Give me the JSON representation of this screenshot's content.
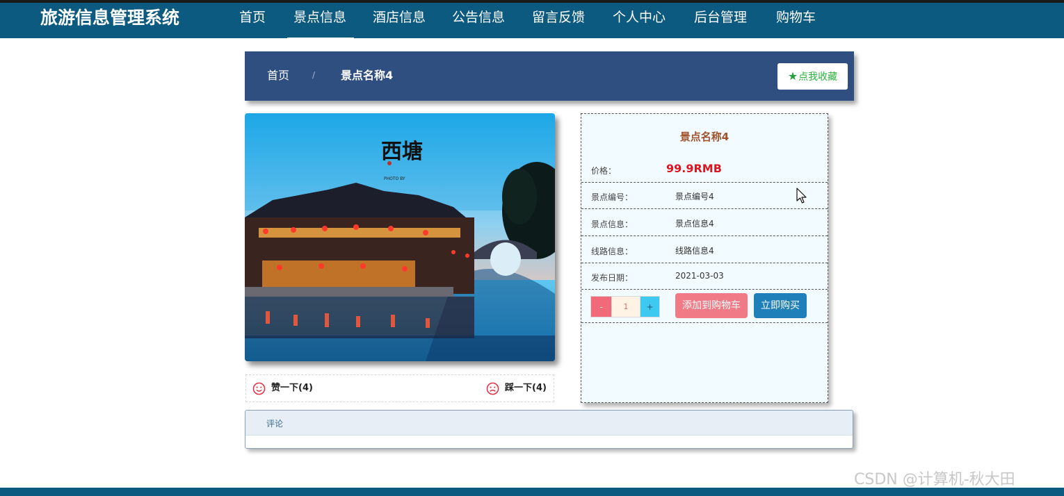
{
  "nav": {
    "brand": "旅游信息管理系统",
    "items": [
      {
        "label": "首页"
      },
      {
        "label": "景点信息"
      },
      {
        "label": "酒店信息"
      },
      {
        "label": "公告信息"
      },
      {
        "label": "留言反馈"
      },
      {
        "label": "个人中心"
      },
      {
        "label": "后台管理"
      },
      {
        "label": "购物车"
      }
    ],
    "active": "景点信息"
  },
  "breadcrumb": {
    "home": "首页",
    "separator": "/",
    "current": "景点名称4",
    "favorite_icon": "star-icon",
    "favorite_label": "点我收藏"
  },
  "votes": {
    "like_icon": "smile-icon",
    "like_label": "赞一下(4)",
    "dislike_icon": "sad-face-icon",
    "dislike_label": "踩一下(4)"
  },
  "detail": {
    "title": "景点名称4",
    "price_label": "价格：",
    "price_value": "99.9RMB",
    "fields": [
      {
        "label": "景点编号：",
        "value": "景点编号4"
      },
      {
        "label": "景点信息：",
        "value": "景点信息4"
      },
      {
        "label": "线路信息：",
        "value": "线路信息4"
      },
      {
        "label": "发布日期：",
        "value": "2021-03-03"
      }
    ],
    "quantity": {
      "minus": "-",
      "value": "1",
      "plus": "+"
    },
    "add_to_cart": "添加到购物车",
    "buy_now": "立即购买"
  },
  "comments": {
    "label": "评论"
  },
  "watermark": "CSDN @计算机-秋大田",
  "colors": {
    "nav_bg": "#0d5a80",
    "breadcrumb_bg": "#2e4f80",
    "price": "#e0141e",
    "title": "#a0522d",
    "cart_button": "#f07a86",
    "buy_button": "#1f7fb8"
  }
}
